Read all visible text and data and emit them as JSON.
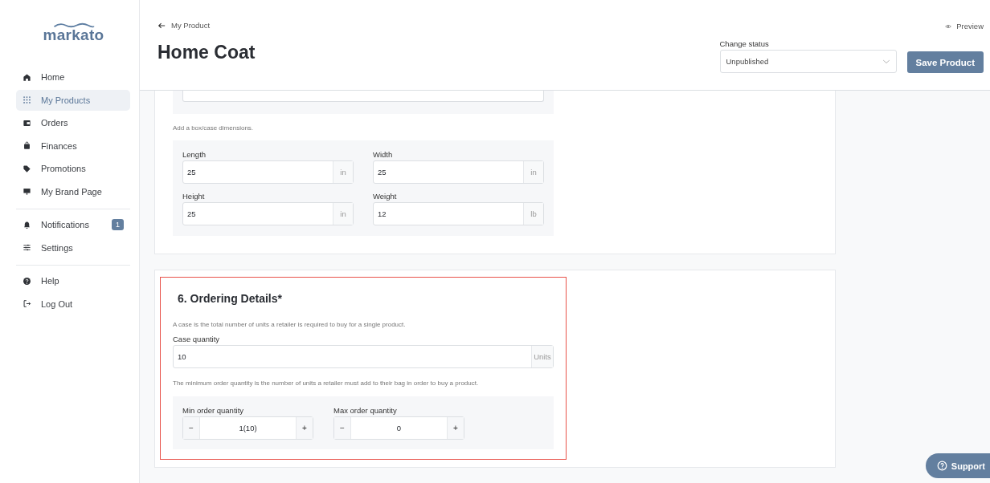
{
  "logo": "markato",
  "sidebar": {
    "items": [
      {
        "label": "Home",
        "kind": "home",
        "selected": false
      },
      {
        "label": "My Products",
        "kind": "grid",
        "selected": true
      },
      {
        "label": "Orders",
        "kind": "wallet",
        "selected": false
      },
      {
        "label": "Finances",
        "kind": "bag",
        "selected": false
      },
      {
        "label": "Promotions",
        "kind": "tag",
        "selected": false
      },
      {
        "label": "My Brand Page",
        "kind": "monitor",
        "selected": false
      }
    ],
    "secondary": [
      {
        "label": "Notifications",
        "kind": "bell",
        "badge": "1"
      },
      {
        "label": "Settings",
        "kind": "sliders"
      }
    ],
    "footer": [
      {
        "label": "Help",
        "kind": "help"
      },
      {
        "label": "Log Out",
        "kind": "logout"
      }
    ]
  },
  "header": {
    "back_link": "My Product",
    "title": "Home Coat",
    "preview": "Preview",
    "status_label": "Change status",
    "status_value": "Unpublished",
    "save_button": "Save Product"
  },
  "dimensions": {
    "hint": "Add a box/case dimensions.",
    "fields": [
      {
        "label": "Length",
        "value": "25",
        "unit": "in"
      },
      {
        "label": "Width",
        "value": "25",
        "unit": "in"
      },
      {
        "label": "Height",
        "value": "25",
        "unit": "in"
      },
      {
        "label": "Weight",
        "value": "12",
        "unit": "lb"
      }
    ]
  },
  "ordering": {
    "title": "6. Ordering Details*",
    "case_hint": "A case is the total number of units a retailer is required to buy for a single product.",
    "case_label": "Case quantity",
    "case_value": "10",
    "case_unit": "Units",
    "min_hint": "The minimum order quantity is the number of units a retailer must add to their bag in order to buy a product.",
    "steppers": [
      {
        "label": "Min order quantity",
        "value": "1(10)",
        "minus": "−",
        "plus": "+"
      },
      {
        "label": "Max order quantity",
        "value": "0",
        "minus": "−",
        "plus": "+"
      }
    ]
  },
  "support_button": "Support"
}
